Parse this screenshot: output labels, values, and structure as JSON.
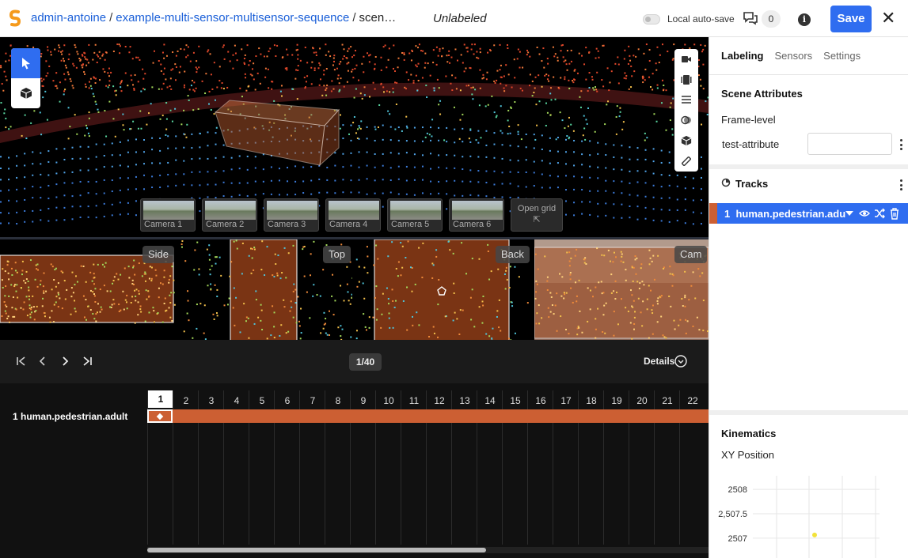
{
  "header": {
    "breadcrumbs": [
      {
        "text": "admin-antoine"
      },
      {
        "text": "example-multi-sensor-multisensor-sequence"
      },
      {
        "text": "scen…"
      }
    ],
    "separator": "/",
    "status": "Unlabeled",
    "autosave_label": "Local auto-save",
    "autosave_on": false,
    "comment_count": "0",
    "info_glyph": "i",
    "save_label": "Save",
    "close_glyph": "✕",
    "accent_color": "#2f6df0"
  },
  "viewer": {
    "cameras": [
      "Camera 1",
      "Camera 2",
      "Camera 3",
      "Camera 4",
      "Camera 5",
      "Camera 6"
    ],
    "open_grid_label": "Open grid",
    "open_grid_glyph": "⇱",
    "left_tools": [
      "cursor-icon",
      "cuboid-icon"
    ],
    "right_tools": [
      "camera-icon",
      "layers-icon",
      "list-icon",
      "overlap-icon",
      "cube-icon",
      "ruler-icon"
    ],
    "views": [
      "Side",
      "Top",
      "Back",
      "Cam"
    ]
  },
  "controls": {
    "frame_indicator": "1/40",
    "details_label": "Details"
  },
  "timeline": {
    "track_label": "1 human.pedestrian.adult",
    "frames": [
      "1",
      "2",
      "3",
      "4",
      "5",
      "6",
      "7",
      "8",
      "9",
      "10",
      "11",
      "12",
      "13",
      "14",
      "15",
      "16",
      "17",
      "18",
      "19",
      "20",
      "21",
      "22"
    ],
    "active_frame": "1",
    "track_color": "#cc5f33"
  },
  "panel": {
    "tabs": [
      {
        "label": "Labeling",
        "active": true
      },
      {
        "label": "Sensors"
      },
      {
        "label": "Settings"
      }
    ],
    "scene_attributes_title": "Scene Attributes",
    "frame_level_label": "Frame-level",
    "attribute_name": "test-attribute",
    "attribute_value": "",
    "tracks_title": "Tracks",
    "track_index": "1",
    "track_name": "human.pedestrian.adu",
    "kinematics_title": "Kinematics",
    "xy_position_label": "XY Position",
    "y_ticks": [
      "2508",
      "2,507.5",
      "2507"
    ]
  },
  "chart_data": {
    "type": "scatter",
    "title": "XY Position",
    "yticks": [
      "2508",
      "2,507.5",
      "2507"
    ],
    "ylim": [
      2506.9,
      2508.1
    ],
    "points": [
      {
        "y": 2507.0
      }
    ],
    "grid": true
  }
}
